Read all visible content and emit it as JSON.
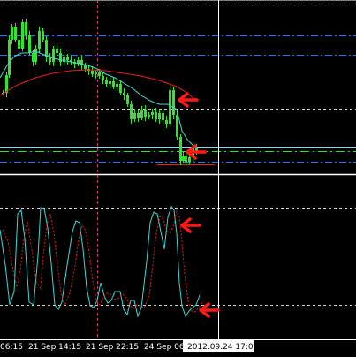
{
  "colors": {
    "background": "#000000",
    "candle": "#2ee62e",
    "ma_fast": "#40e0d0",
    "ma_slow": "#e62020",
    "stoch_main": "#40d8d8",
    "stoch_signal": "#e62020",
    "level_dotted": "#d0d0d0",
    "level_blue": "#1e78ff",
    "level_green": "#2ee62e",
    "cursor": "#ffffff",
    "period_sep": "#c83c78",
    "arrow": "#ff1a1a"
  },
  "price_panel": {
    "ma_fast_icon": "line-icon",
    "ma_slow_icon": "line-icon"
  },
  "time_axis": {
    "labels": [
      "06:15",
      "21 Sep 14:15",
      "21 Sep 22:15",
      "24 Sep 06:",
      ""
    ],
    "cursor_label": "2012.09.24 17:00"
  },
  "annotations": {
    "arrow_icon": "left-arrow-icon"
  }
}
